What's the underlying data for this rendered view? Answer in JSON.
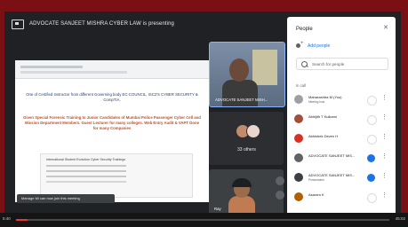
{
  "presenting": {
    "text": "ADVOCATE SANJEET MISHRA CYBER LAW is presenting"
  },
  "slide": {
    "line1": "One of Certified Instructor from different Governing body EC-COUNCIL, ISC2'S CYBER SECURITY & CompTIA.",
    "line2": "Given Special Forensic Training to Junior Candidates of Mumbai Police Passenger Cyber Cell and Mission Department Members. Guest Lecturer for many colleges. Web Entry Audit & VAPT Done for many Companies",
    "card_title": "International Student Evolution Cyber Security Trainings"
  },
  "toast": "Manage Mi can now join this meeting",
  "tiles": {
    "main_name": "ADVOCATE SANJEET MISH...",
    "others_label": "33 others",
    "ray_name": "Ray"
  },
  "people": {
    "title": "People",
    "close_icon": "close-icon",
    "add_label": "Add people",
    "search_placeholder": "Search for people",
    "in_call": "In call",
    "rows": [
      {
        "name": "Maharashtra M (You)",
        "sub": "Meeting host",
        "color": "#9aa0a6",
        "mic": "#ffffff"
      },
      {
        "name": "Abhijith T Kulkarni",
        "sub": "",
        "color": "#a14f36",
        "mic": "#ffffff"
      },
      {
        "name": "Abhishek Deven H",
        "sub": "",
        "color": "#d93025",
        "mic": "#ffffff"
      },
      {
        "name": "ADVOCATE SANJEET MIS...",
        "sub": "",
        "color": "#5f6368",
        "mic": "#1a73e8"
      },
      {
        "name": "ADVOCATE SANJEET MIS...",
        "sub": "Presentation",
        "color": "#3c4043",
        "mic": "#1a73e8"
      },
      {
        "name": "Asaram K",
        "sub": "",
        "color": "#b06000",
        "mic": "#ffffff"
      }
    ]
  },
  "playback": {
    "elapsed": "5:40",
    "duration": "45:02",
    "progress": 0.03
  }
}
